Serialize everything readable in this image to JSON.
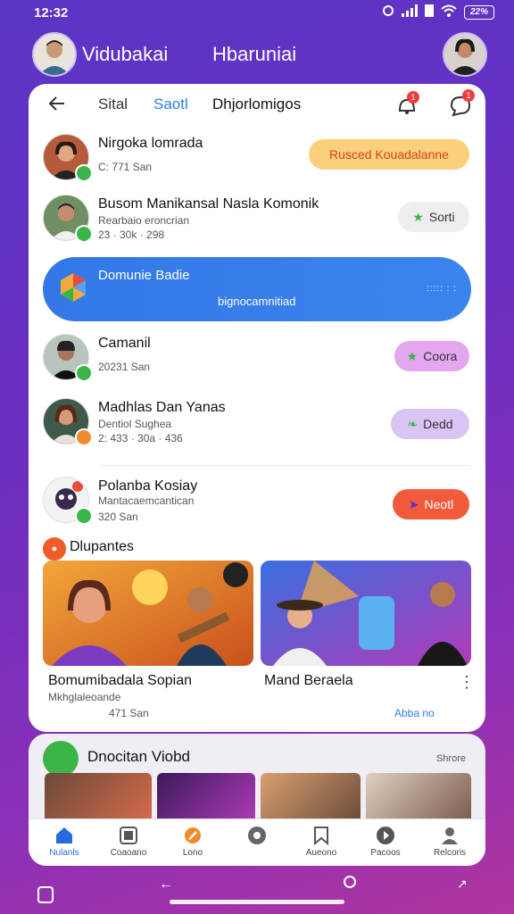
{
  "status": {
    "time": "12:32",
    "battery": "22%"
  },
  "header": {
    "user_name": "Vidubakai",
    "center_title": "Hbaruniai"
  },
  "nav": {
    "tab1": "Sital",
    "tab2": "Saotl",
    "tab3": "Dhjorlomigos",
    "notif_badge": "1",
    "chat_badge": "1"
  },
  "rows": [
    {
      "title": "Nirgoka lomrada",
      "meta": "C: 771 San",
      "button": "Rusced Kouadalanne",
      "button_color": "#fbd07a"
    },
    {
      "title": "Busom Manikansal Nasla Komonik",
      "sub": "Rearbaio eroncrian",
      "meta": "23 · 30k · 298",
      "button": "Sorti",
      "button_color": "#eeeeee"
    },
    {
      "title": "Camanil",
      "meta": "20231 San",
      "button": "Coora",
      "button_color": "#e3a6ef"
    },
    {
      "title": "Madhlas Dan Yanas",
      "sub": "Dentiol Sughea",
      "meta": "2: 433 · 30a · 436",
      "button": "Dedd",
      "button_color": "#d9c4f3"
    },
    {
      "title": "Polanba Kosiay",
      "sub": "Mantacaemcantican",
      "meta": "320 San",
      "button": "Neotl",
      "button_color": "#f15b3c"
    }
  ],
  "banner": {
    "title": "Domunie Badie",
    "subtitle": "bignocamnitiad",
    "dots": "::::: : :"
  },
  "section": {
    "title": "Dlupantes"
  },
  "videos": [
    {
      "title": "Bomumibadala Sopian",
      "sub": "Mkhglaleoande",
      "meta": "471 San"
    },
    {
      "title": "Mand Beraela",
      "meta": "Abba no"
    }
  ],
  "section2": {
    "title": "Dnocitan Viobd",
    "more": "Shrore"
  },
  "tabs": [
    "Nulanls",
    "Coaoano",
    "Lono",
    "",
    "Aueono",
    "Pacoos",
    "Relcoris"
  ],
  "colors": {
    "accent": "#2a7de1",
    "bg_start": "#5a35c6",
    "bg_end": "#b0359e"
  }
}
